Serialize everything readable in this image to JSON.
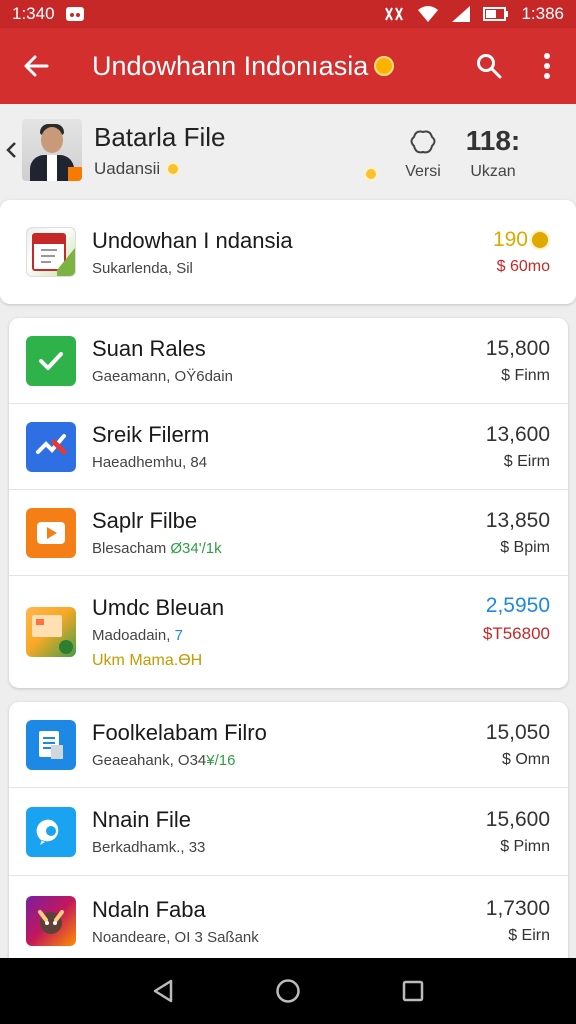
{
  "status_bar": {
    "time": "1:340",
    "clock_right": "1:386"
  },
  "app_bar": {
    "title": "Undowhann Indonıasia"
  },
  "profile": {
    "name": "Batarla File",
    "subtitle": "Uadansii",
    "stat_label": "Versi",
    "stat_value_label": "Ukzan",
    "stat_value": "118:"
  },
  "featured": {
    "title": "Undowhan I ndansia",
    "subtitle": "Sukarlenda, Sil",
    "amount": "190",
    "unit": "$ 60mo",
    "colors": {
      "amount": "#e0a800",
      "unit": "#c62828"
    }
  },
  "group1": [
    {
      "title": "Suan Rales",
      "subtitle": "Gaeamann, OŸ6dain",
      "amount": "15,800",
      "unit": "$ Finm",
      "icon": "check-icon"
    },
    {
      "title": "Sreik Filerm",
      "subtitle": "Haeadhemhu, 84",
      "amount": "13,600",
      "unit": "$ Eirm",
      "icon": "brush-icon"
    },
    {
      "title": "Saplr Filbe",
      "subtitle": "Blesacham ",
      "subtitle_accent": "Ø34'/1k",
      "amount": "13,850",
      "unit": "$ Bpim",
      "icon": "play-icon"
    },
    {
      "title": "Umdc Bleuan",
      "subtitle": "Madoadain, ",
      "subtitle_accent": "7",
      "extra": "Ukm Mama.ƟH",
      "amount": "2,5950",
      "unit": "$T56800",
      "icon": "card-icon"
    }
  ],
  "group2": [
    {
      "title": "Foolkelabam Filro",
      "subtitle": "Geaeahank, O34",
      "subtitle_accent": "¥/16",
      "amount": "15,050",
      "unit": "$ Omn",
      "icon": "document-icon"
    },
    {
      "title": "Nnain File",
      "subtitle": "Berkadhamk., 33",
      "amount": "15,600",
      "unit": "$ Pimn",
      "icon": "chat-icon"
    },
    {
      "title": "Ndaln Faba",
      "subtitle": "Noandeare, OI 3 Saßank",
      "amount": "1,7300",
      "unit": "$ Eirn",
      "icon": "game-icon"
    }
  ],
  "colors": {
    "app_bar": "#d32f2f",
    "status_bar": "#c62828",
    "accent_green": "#2e9e44",
    "accent_blue": "#1e88e5",
    "accent_red": "#c62828"
  }
}
